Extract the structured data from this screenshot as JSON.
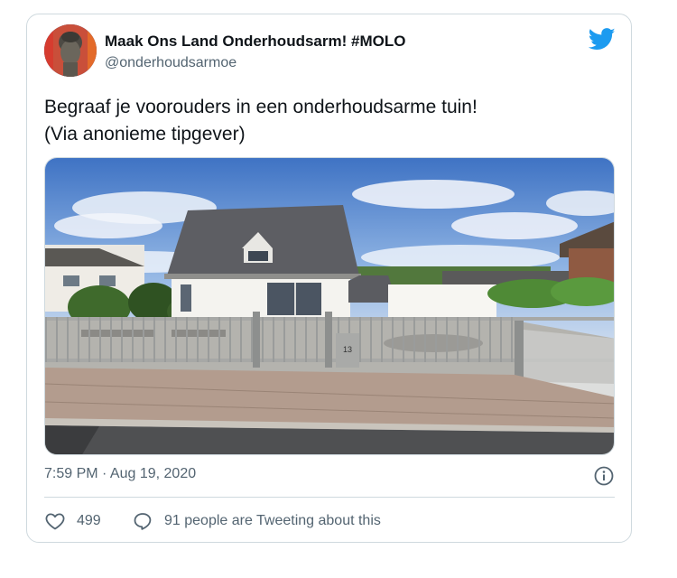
{
  "tweet": {
    "display_name": "Maak Ons Land Onderhoudsarm! #MOLO",
    "handle": "@onderhoudsarmoe",
    "text_line1": "Begraaf je voorouders in een onderhoudsarme tuin!",
    "text_line2": "(Via anonieme tipgever)",
    "timestamp": "7:59 PM · Aug 19, 2020",
    "likes": "499",
    "reply_text": "91 people are Tweeting about this",
    "house_number": "13"
  },
  "icons": {
    "brand": "twitter-bird-icon",
    "info": "info-icon",
    "like": "heart-icon",
    "reply": "speech-bubble-icon"
  },
  "colors": {
    "brand_blue": "#1d9bf0",
    "text_primary": "#0f1419",
    "text_secondary": "#536471",
    "border": "#cfd9de"
  }
}
